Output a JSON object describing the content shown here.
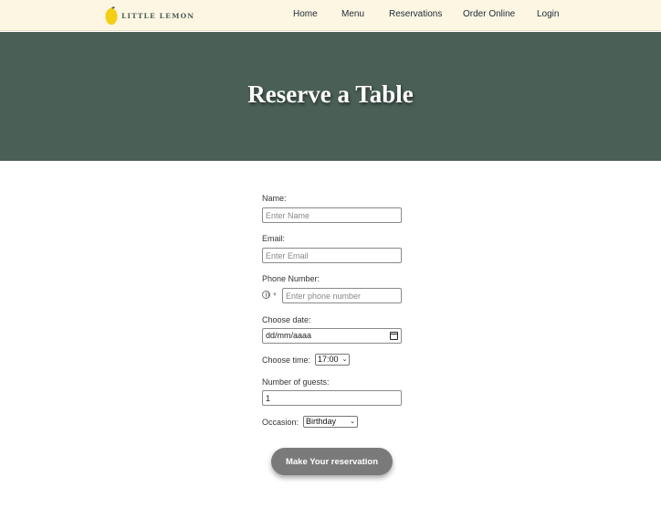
{
  "brand": {
    "name": "LITTLE LEMON",
    "colors": {
      "green": "#495e57",
      "yellow": "#f4ce14",
      "cream": "#fdf6e3"
    }
  },
  "nav": {
    "items": [
      {
        "label": "Home"
      },
      {
        "label": "Menu"
      },
      {
        "label": "Reservations"
      },
      {
        "label": "Order Online"
      },
      {
        "label": "Login"
      }
    ]
  },
  "hero": {
    "title": "Reserve a Table"
  },
  "form": {
    "name": {
      "label": "Name:",
      "placeholder": "Enter Name"
    },
    "email": {
      "label": "Email:",
      "placeholder": "Enter Email"
    },
    "phone": {
      "label": "Phone Number:",
      "placeholder": "Enter phone number",
      "icon": "globe-icon"
    },
    "date": {
      "label": "Choose date:",
      "value": "dd/mm/aaaa",
      "icon": "calendar-icon"
    },
    "time": {
      "label": "Choose time:",
      "value": "17:00"
    },
    "guests": {
      "label": "Number of guests:",
      "value": "1"
    },
    "occasion": {
      "label": "Occasion:",
      "value": "Birthday"
    },
    "submit_label": "Make Your reservation"
  }
}
